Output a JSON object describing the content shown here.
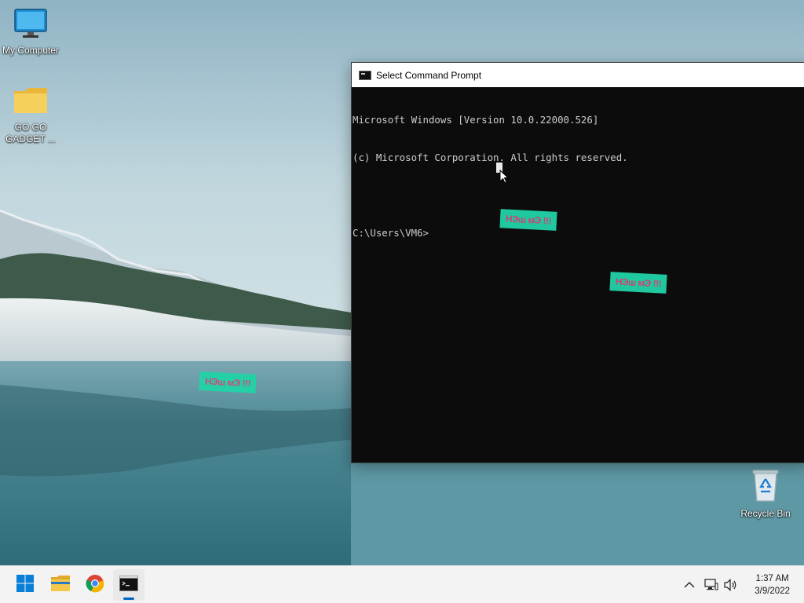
{
  "desktop": {
    "icons": [
      {
        "label": "My Computer",
        "icon": "monitor-icon"
      },
      {
        "label": "GO GO GADGET ...",
        "icon": "folder-icon"
      },
      {
        "label": "Recycle Bin",
        "icon": "recycle-bin-icon"
      }
    ]
  },
  "cmd": {
    "title": "Select Command Prompt",
    "lines": [
      "Microsoft Windows [Version 10.0.22000.526]",
      "(c) Microsoft Corporation. All rights reserved.",
      "",
      "C:\\Users\\VM6>"
    ]
  },
  "overlays": {
    "tag_text": "НЭш мЭ !!!"
  },
  "taskbar": {
    "apps": [
      {
        "name": "start",
        "icon": "windows-start-icon"
      },
      {
        "name": "file-explorer",
        "icon": "folder-icon"
      },
      {
        "name": "chrome",
        "icon": "chrome-icon"
      },
      {
        "name": "command-prompt",
        "icon": "terminal-icon",
        "active": true
      }
    ],
    "tray": {
      "chevron": "chevron-up-icon",
      "network": "network-icon",
      "volume": "speaker-icon"
    },
    "clock": {
      "time": "1:37 AM",
      "date": "3/9/2022"
    }
  },
  "colors": {
    "accent": "#0067c0",
    "tag_bg": "#22d3a7",
    "tag_text": "#d9457a",
    "console_bg": "#0c0c0c",
    "console_text": "#cccccc"
  }
}
